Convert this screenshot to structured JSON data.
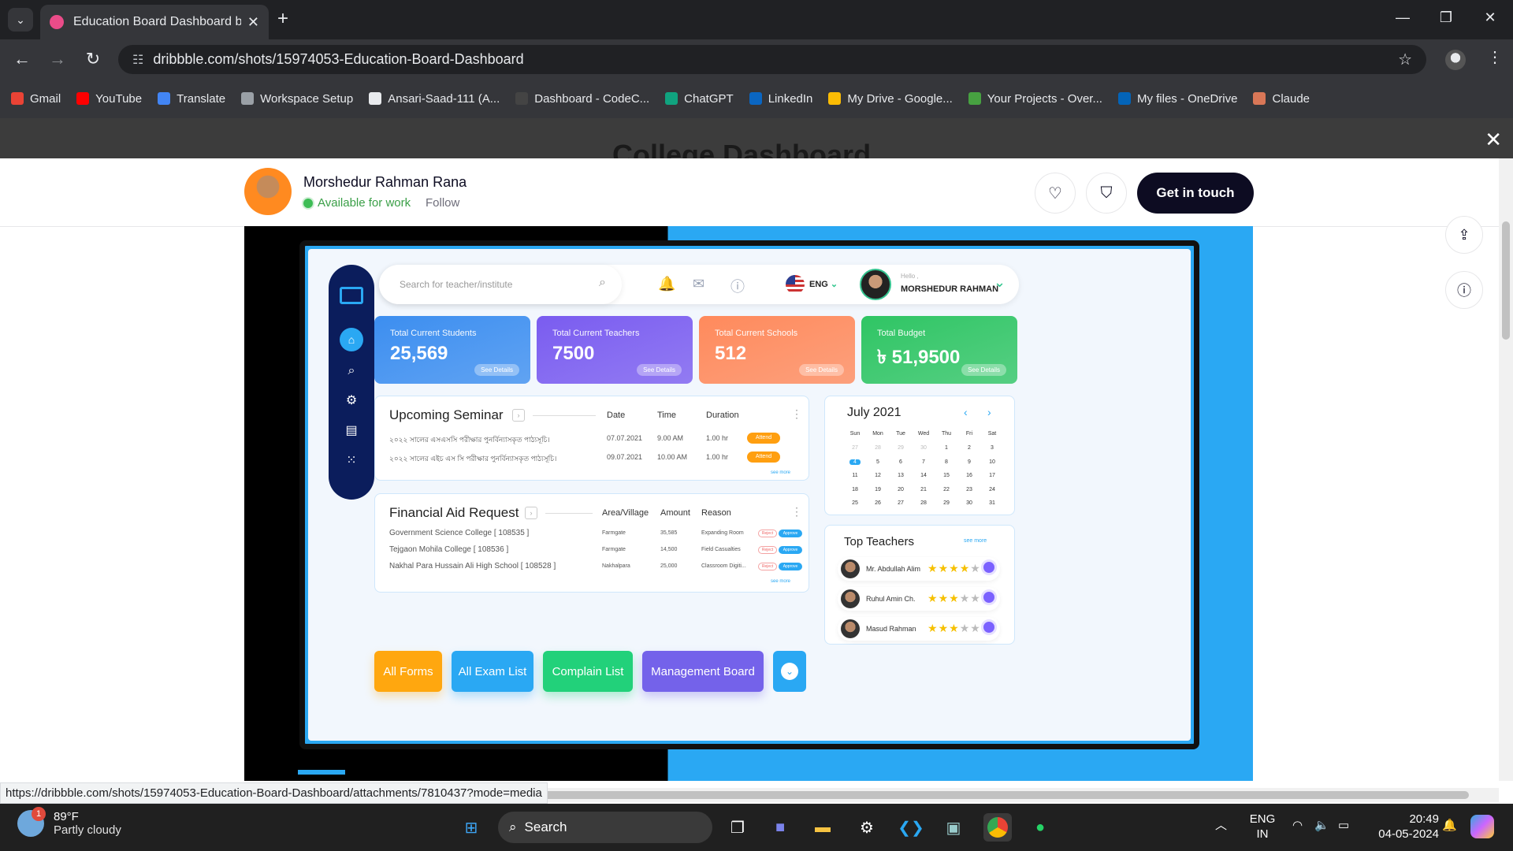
{
  "browser": {
    "tab_title": "Education Board Dashboard by",
    "url": "dribbble.com/shots/15974053-Education-Board-Dashboard",
    "bookmarks": [
      {
        "label": "Gmail",
        "color": "#ea4335",
        "icon": "gmail-icon"
      },
      {
        "label": "YouTube",
        "color": "#ff0000",
        "icon": "youtube-icon"
      },
      {
        "label": "Translate",
        "color": "#4285f4",
        "icon": "translate-icon"
      },
      {
        "label": "Workspace Setup",
        "color": "#9aa0a6",
        "icon": "lock-icon"
      },
      {
        "label": "Ansari-Saad-111 (A...",
        "color": "#e8eaed",
        "icon": "github-icon"
      },
      {
        "label": "Dashboard - CodeC...",
        "color": "#444",
        "icon": "codechef-icon"
      },
      {
        "label": "ChatGPT",
        "color": "#10a37f",
        "icon": "chatgpt-icon"
      },
      {
        "label": "LinkedIn",
        "color": "#0a66c2",
        "icon": "linkedin-icon"
      },
      {
        "label": "My Drive - Google...",
        "color": "#fbbc04",
        "icon": "drive-icon"
      },
      {
        "label": "Your Projects - Over...",
        "color": "#47a141",
        "icon": "overleaf-icon"
      },
      {
        "label": "My files - OneDrive",
        "color": "#0364b8",
        "icon": "onedrive-icon"
      },
      {
        "label": "Claude",
        "color": "#d97757",
        "icon": "claude-icon"
      }
    ],
    "status_url": "https://dribbble.com/shots/15974053-Education-Board-Dashboard/attachments/7810437?mode=media"
  },
  "overlay": {
    "background_title": "College Dashboard"
  },
  "shot": {
    "designer_name": "Morshedur Rahman Rana",
    "availability": "Available for work",
    "follow_label": "Follow",
    "get_in_touch_label": "Get in touch"
  },
  "dashboard": {
    "search_placeholder": "Search for teacher/institute",
    "language": "ENG",
    "hello": "Hello ,",
    "user_name": "MORSHEDUR RAHMAN",
    "cards": [
      {
        "label": "Total Current Students",
        "value": "25,569",
        "button": "See Details",
        "color": "#3c8ef0"
      },
      {
        "label": "Total Current Teachers",
        "value": "7500",
        "button": "See Details",
        "color": "#7a5cf0"
      },
      {
        "label": "Total Current Schools",
        "value": "512",
        "button": "See Details",
        "color": "#ff8a5c"
      },
      {
        "label": "Total Budget",
        "value": "৳ 51,9500",
        "button": "See Details",
        "color": "#2fc564"
      }
    ],
    "seminar": {
      "title": "Upcoming Seminar",
      "headers": {
        "date": "Date",
        "time": "Time",
        "duration": "Duration"
      },
      "rows": [
        {
          "name": "২০২২ সালের এসএসসি পরীক্ষার পুনর্বিন্যাসকৃত পাঠ্যসূচি।",
          "date": "07.07.2021",
          "time": "9.00 AM",
          "duration": "1.00 hr",
          "action": "Attend"
        },
        {
          "name": "২০২২ সালের এইচ এস সি পরীক্ষার পুনর্বিন্যাসকৃত পাঠ্যসূচি।",
          "date": "09.07.2021",
          "time": "10.00 AM",
          "duration": "1.00 hr",
          "action": "Attend"
        }
      ],
      "see_more": "see more"
    },
    "aid": {
      "title": "Financial Aid Request",
      "headers": {
        "area": "Area/Village",
        "amount": "Amount",
        "reason": "Reason"
      },
      "rows": [
        {
          "name": "Government Science College  [ 108535 ]",
          "area": "Farmgate",
          "amount": "35,585",
          "reason": "Expanding Room"
        },
        {
          "name": "Tejgaon Mohila College [ 108536 ]",
          "area": "Farmgate",
          "amount": "14,500",
          "reason": "Field Casualties"
        },
        {
          "name": "Nakhal Para Hussain Ali High School  [ 108528 ]",
          "area": "Nakhalpara",
          "amount": "25,000",
          "reason": "Classroom Digiti..."
        }
      ],
      "reject": "Reject",
      "approve": "Approve",
      "see_more": "see more"
    },
    "calendar": {
      "month": "July  2021",
      "weekdays": [
        "Sun",
        "Mon",
        "Tue",
        "Wed",
        "Thu",
        "Fri",
        "Sat"
      ],
      "days": [
        "27",
        "28",
        "29",
        "30",
        "1",
        "2",
        "3",
        "4",
        "5",
        "6",
        "7",
        "8",
        "9",
        "10",
        "11",
        "12",
        "13",
        "14",
        "15",
        "16",
        "17",
        "18",
        "19",
        "20",
        "21",
        "22",
        "23",
        "24",
        "25",
        "26",
        "27",
        "28",
        "29",
        "30",
        "31"
      ],
      "selected_day": "4"
    },
    "top_teachers": {
      "title": "Top Teachers",
      "see_more": "see more",
      "teachers": [
        {
          "name": "Mr. Abdullah Alim",
          "rating": 4
        },
        {
          "name": "Ruhul Amin Ch.",
          "rating": 3
        },
        {
          "name": "Masud Rahman",
          "rating": 3
        }
      ]
    },
    "quick_buttons": [
      {
        "label": "All Forms",
        "color": "#ffa70f"
      },
      {
        "label": "All Exam List",
        "color": "#2aa8f3"
      },
      {
        "label": "Complain List",
        "color": "#22d17a"
      },
      {
        "label": "Management Board",
        "color": "#7462ea"
      }
    ]
  },
  "taskbar": {
    "temperature": "89°F",
    "weather": "Partly cloudy",
    "weather_badge": "1",
    "search_label": "Search",
    "lang_line1": "ENG",
    "lang_line2": "IN",
    "time": "20:49",
    "date": "04-05-2024"
  }
}
